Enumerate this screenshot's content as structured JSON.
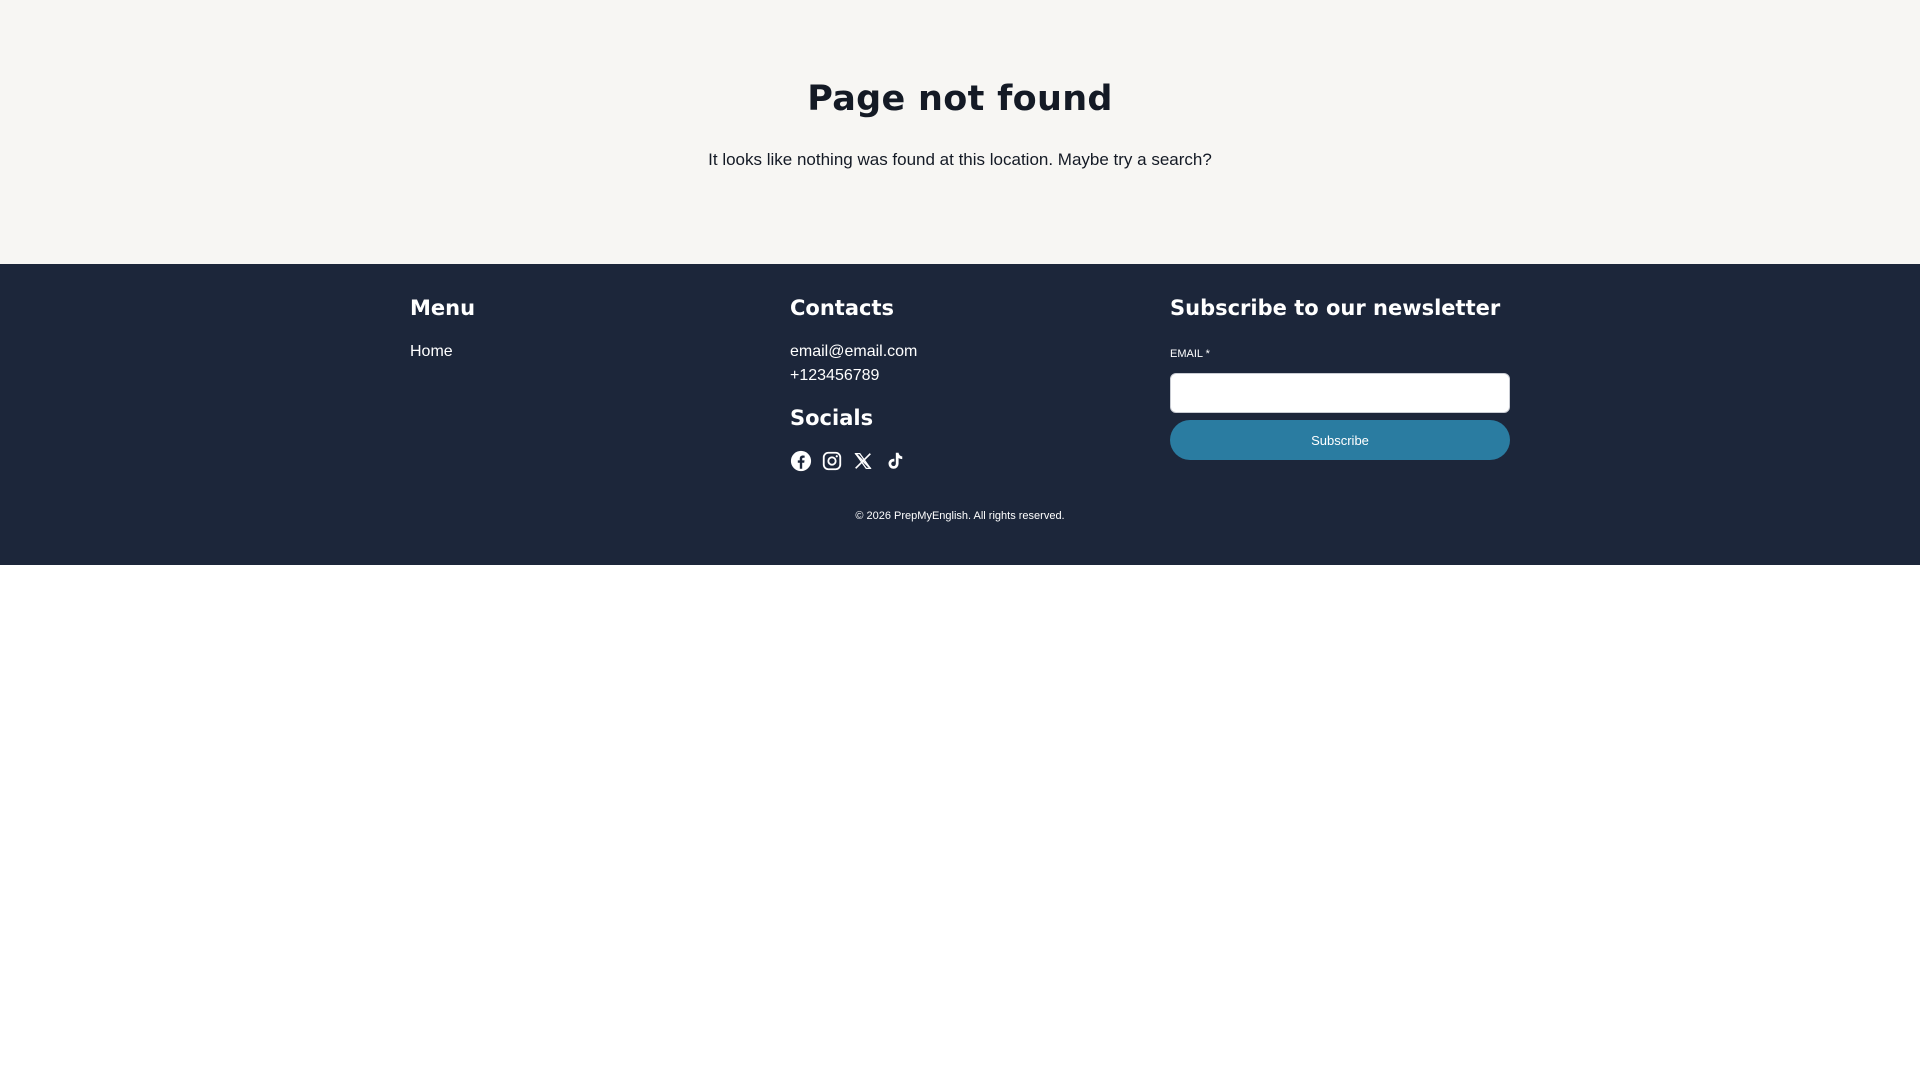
{
  "hero": {
    "title": "Page not found",
    "message": "It looks like nothing was found at this location. Maybe try a search?"
  },
  "footer": {
    "menu": {
      "heading": "Menu",
      "items": [
        {
          "label": "Home"
        }
      ]
    },
    "contacts": {
      "heading": "Contacts",
      "email": "email@email.com",
      "phone": "+123456789"
    },
    "socials": {
      "heading": "Socials",
      "icons": [
        "facebook-icon",
        "instagram-icon",
        "x-icon",
        "tiktok-icon"
      ]
    },
    "newsletter": {
      "heading": "Subscribe to our newsletter",
      "email_label": "EMAIL *",
      "email_value": "",
      "subscribe_label": "Subscribe"
    },
    "copyright": "© 2026 PrepMyEnglish. All rights reserved."
  },
  "colors": {
    "hero_bg": "#f7f6f3",
    "footer_bg": "#1c263a",
    "accent": "#2a7ca1",
    "text_dark": "#141a25"
  }
}
